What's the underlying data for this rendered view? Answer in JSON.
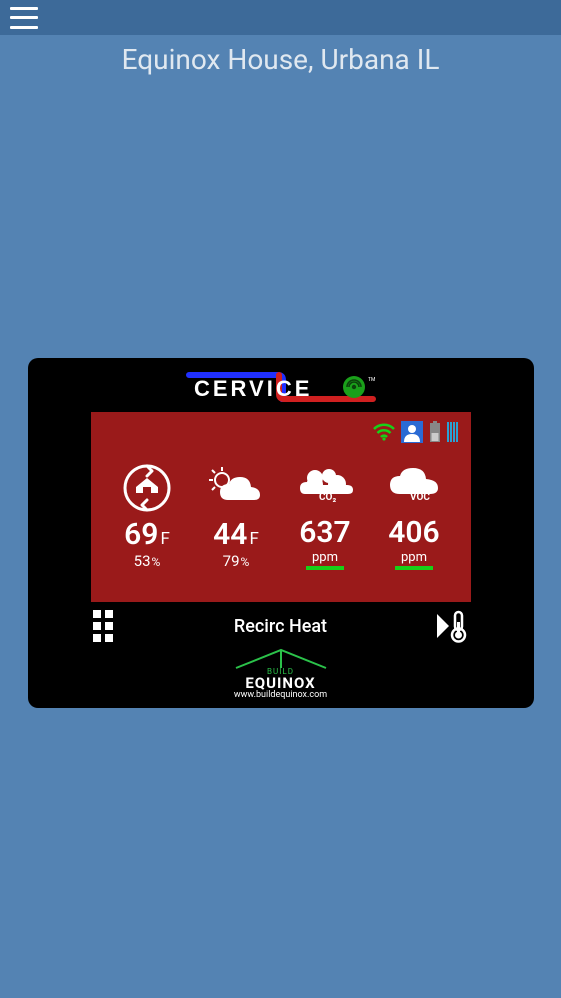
{
  "header": {
    "title": "Equinox House, Urbana IL"
  },
  "logo": {
    "text": "CERVICE"
  },
  "readings": {
    "indoor": {
      "temp": "69",
      "temp_unit": "F",
      "hum": "53",
      "hum_unit": "%"
    },
    "outdoor": {
      "temp": "44",
      "temp_unit": "F",
      "hum": "79",
      "hum_unit": "%"
    },
    "co2": {
      "value": "637",
      "label": "ppm",
      "tag": "CO₂"
    },
    "voc": {
      "value": "406",
      "label": "ppm",
      "tag": "VOC"
    }
  },
  "mode": "Recirc Heat",
  "footer": {
    "build": "BUILD",
    "brand": "EQUINOX",
    "url": "www.buildequinox.com"
  }
}
